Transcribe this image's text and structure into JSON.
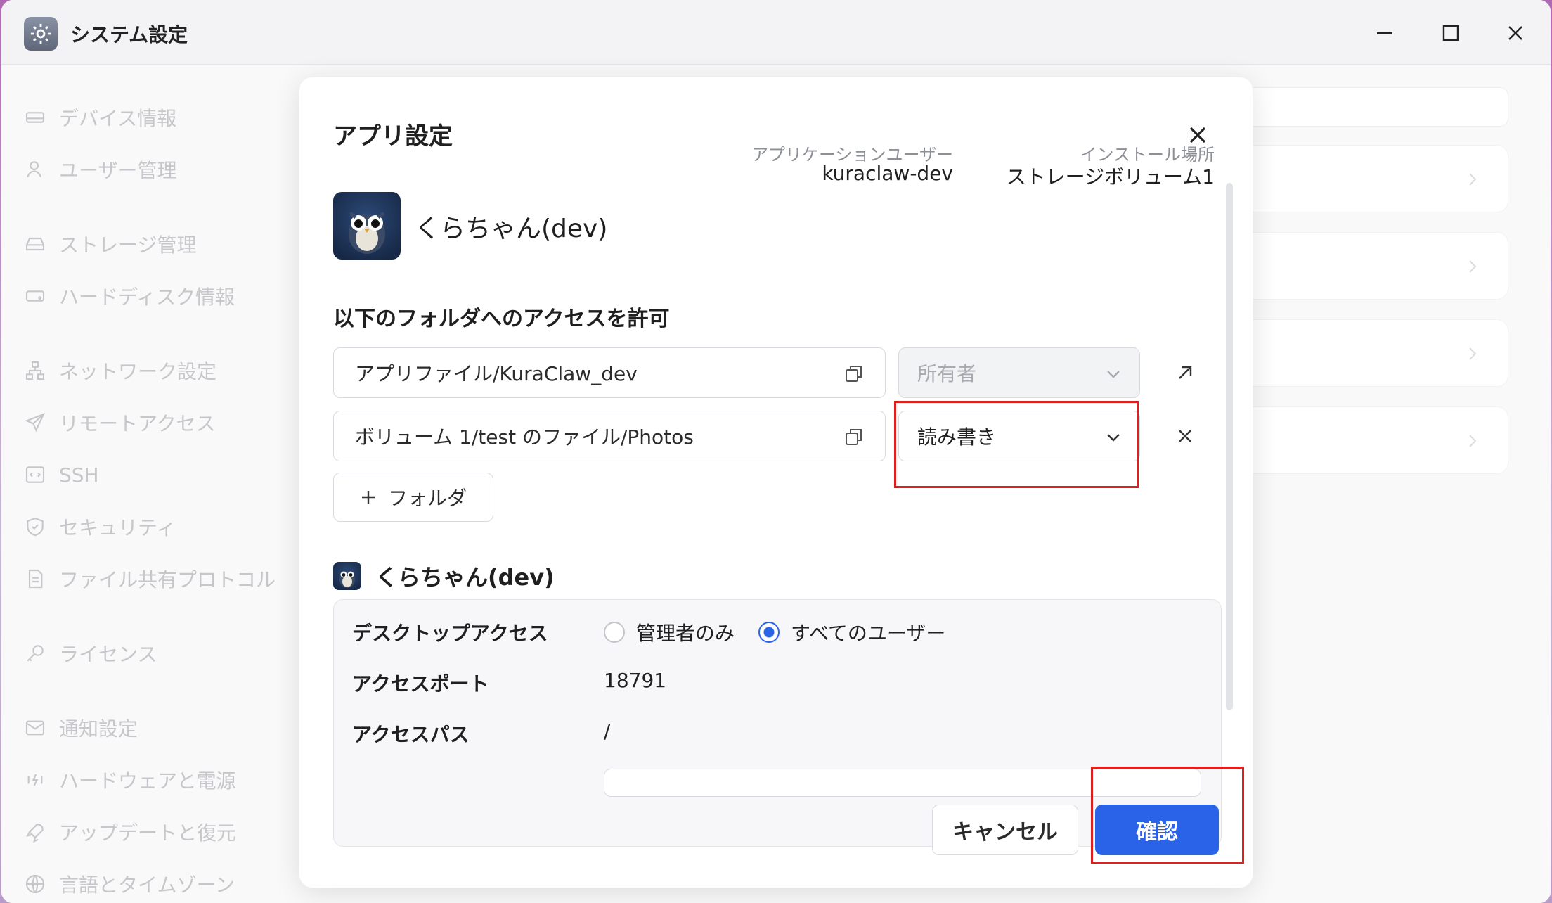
{
  "window": {
    "title": "システム設定"
  },
  "sidebar": {
    "items": [
      {
        "label": "デバイス情報",
        "icon": "device-icon"
      },
      {
        "label": "ユーザー管理",
        "icon": "user-icon"
      },
      {
        "label": "ストレージ管理",
        "icon": "storage-icon"
      },
      {
        "label": "ハードディスク情報",
        "icon": "harddisk-icon"
      },
      {
        "label": "ネットワーク設定",
        "icon": "network-icon"
      },
      {
        "label": "リモートアクセス",
        "icon": "send-icon"
      },
      {
        "label": "SSH",
        "icon": "code-icon"
      },
      {
        "label": "セキュリティ",
        "icon": "shield-icon"
      },
      {
        "label": "ファイル共有プロトコル",
        "icon": "document-icon"
      },
      {
        "label": "ライセンス",
        "icon": "key-icon"
      },
      {
        "label": "通知設定",
        "icon": "mail-icon"
      },
      {
        "label": "ハードウェアと電源",
        "icon": "power-icon"
      },
      {
        "label": "アップデートと復元",
        "icon": "rocket-icon"
      },
      {
        "label": "言語とタイムゾーン",
        "icon": "globe-icon"
      }
    ]
  },
  "modal": {
    "title": "アプリ設定",
    "app_name": "くらちゃん(dev)",
    "app_user_label": "アプリケーションユーザー",
    "app_user_value": "kuraclaw-dev",
    "install_location_label": "インストール場所",
    "install_location_value": "ストレージボリューム1",
    "folder_section_title": "以下のフォルダへのアクセスを許可",
    "folders": [
      {
        "path": "アプリファイル/KuraClaw_dev",
        "permission": "所有者"
      },
      {
        "path": "ボリューム 1/test のファイル/Photos",
        "permission": "読み書き"
      }
    ],
    "add_folder_label": "フォルダ",
    "sub_app_name": "くらちゃん(dev)",
    "settings": {
      "desktop_access_label": "デスクトップアクセス",
      "option_admin_only": "管理者のみ",
      "option_all_users": "すべてのユーザー",
      "access_port_label": "アクセスポート",
      "access_port_value": "18791",
      "access_path_label": "アクセスパス",
      "access_path_value": "/"
    },
    "cancel_label": "キャンセル",
    "confirm_label": "確認"
  },
  "colors": {
    "accent": "#2b63e8",
    "highlight": "#e0201f"
  }
}
